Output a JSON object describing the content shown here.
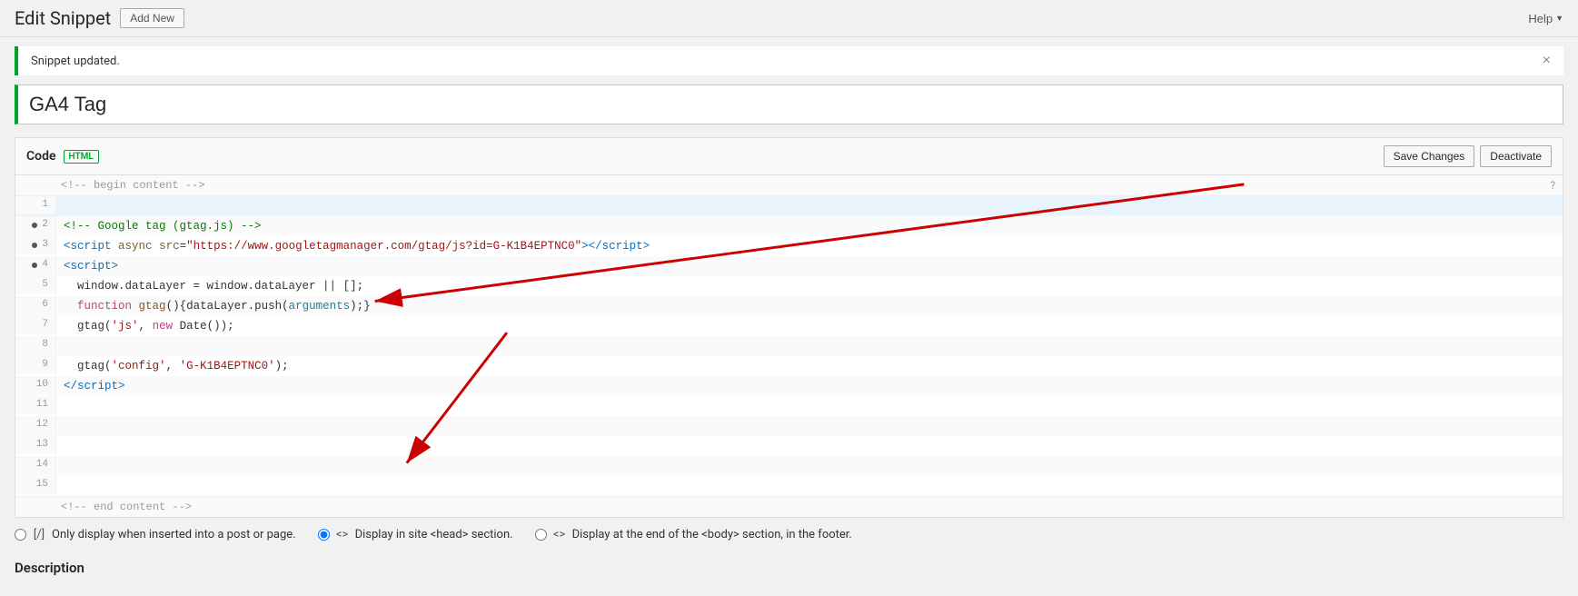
{
  "header": {
    "title": "Edit Snippet",
    "add_new_label": "Add New",
    "help_label": "Help"
  },
  "notice": {
    "text": "Snippet updated.",
    "close_label": "×"
  },
  "snippet": {
    "name": "GA4 Tag"
  },
  "code_section": {
    "label": "Code",
    "badge": "HTML",
    "save_label": "Save Changes",
    "deactivate_label": "Deactivate",
    "comment_top": "<!-- begin content -->",
    "comment_bottom": "<!-- end content -->",
    "lines": [
      {
        "num": 1,
        "has_dot": false,
        "content": ""
      },
      {
        "num": 2,
        "has_dot": true,
        "content": "<!-- Google tag (gtag.js) -->"
      },
      {
        "num": 3,
        "has_dot": true,
        "content": "<script async src=\"https://www.googletagmanager.com/gtag/js?id=G-K1B4EPTNC0\"></script>"
      },
      {
        "num": 4,
        "has_dot": true,
        "content": "<script>"
      },
      {
        "num": 5,
        "has_dot": false,
        "content": "  window.dataLayer = window.dataLayer || [];"
      },
      {
        "num": 6,
        "has_dot": false,
        "content": "  function gtag(){dataLayer.push(arguments);}"
      },
      {
        "num": 7,
        "has_dot": false,
        "content": "  gtag('js', new Date());"
      },
      {
        "num": 8,
        "has_dot": false,
        "content": ""
      },
      {
        "num": 9,
        "has_dot": false,
        "content": "  gtag('config', 'G-K1B4EPTNC0');"
      },
      {
        "num": 10,
        "has_dot": false,
        "content": "</script>"
      },
      {
        "num": 11,
        "has_dot": false,
        "content": ""
      }
    ]
  },
  "display_options": {
    "option1": {
      "label": "[/] Only display when inserted into a post or page.",
      "checked": false
    },
    "option2": {
      "label": "Display in site <head> section.",
      "checked": true
    },
    "option3": {
      "label": "Display at the end of the <body> section, in the footer.",
      "checked": false
    }
  },
  "description": {
    "title": "Description"
  }
}
